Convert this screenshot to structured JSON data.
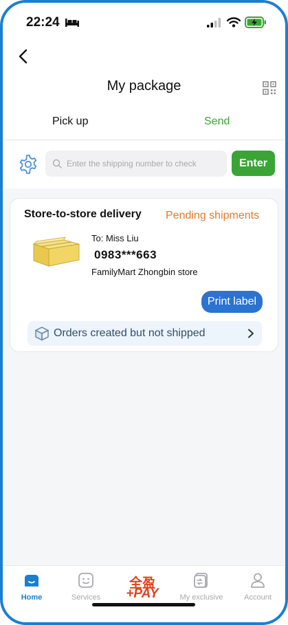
{
  "status_bar": {
    "time": "22:24"
  },
  "header": {
    "title": "My package"
  },
  "tabs": [
    {
      "label": "Pick up"
    },
    {
      "label": "Send"
    }
  ],
  "search": {
    "placeholder": "Enter the shipping number to check",
    "enter_label": "Enter"
  },
  "shipment_card": {
    "title": "Store-to-store delivery",
    "status": "Pending shipments",
    "recipient": "To: Miss Liu",
    "phone": "0983***663",
    "store": "FamilyMart Zhongbin store",
    "print_label": "Print label",
    "orders_row_label": "Orders created but not shipped"
  },
  "bottom_nav": {
    "items": [
      {
        "label": "Home",
        "icon": "home-icon"
      },
      {
        "label": "Services",
        "icon": "services-icon"
      },
      {
        "label": "My exclusive",
        "icon": "coupon-icon"
      },
      {
        "label": "Account",
        "icon": "account-icon"
      }
    ],
    "pay_logo_top": "全盈",
    "pay_logo_bottom": "+PAY"
  },
  "colors": {
    "accent_green": "#3aa535",
    "accent_blue": "#2b73d0",
    "status_orange": "#e07a2b",
    "frame_blue": "#1a7fd1"
  }
}
